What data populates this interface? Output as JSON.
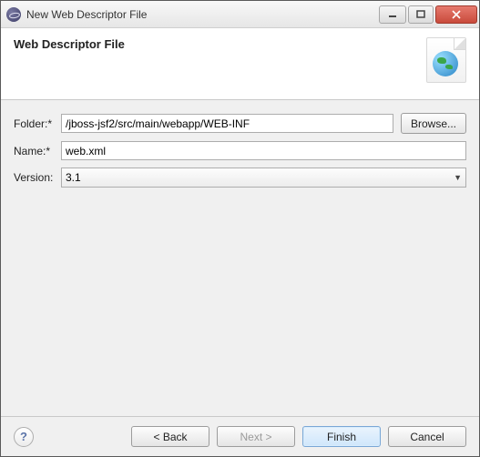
{
  "window": {
    "title": "New Web Descriptor File"
  },
  "banner": {
    "heading": "Web Descriptor File"
  },
  "form": {
    "folder_label": "Folder:*",
    "folder_value": "/jboss-jsf2/src/main/webapp/WEB-INF",
    "browse_label": "Browse...",
    "name_label": "Name:*",
    "name_value": "web.xml",
    "version_label": "Version:",
    "version_value": "3.1"
  },
  "footer": {
    "back_label": "< Back",
    "next_label": "Next >",
    "finish_label": "Finish",
    "cancel_label": "Cancel"
  }
}
